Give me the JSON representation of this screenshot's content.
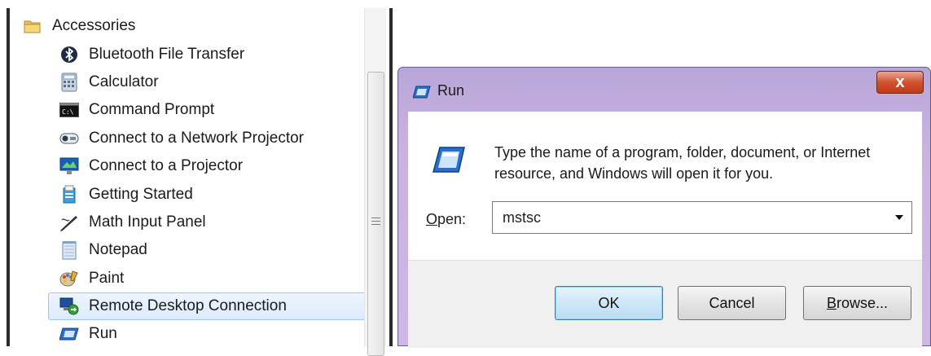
{
  "start_menu": {
    "folder": {
      "label": "Accessories",
      "icon": "folder-icon"
    },
    "items": [
      {
        "label": "Bluetooth File Transfer",
        "icon": "bluetooth-icon"
      },
      {
        "label": "Calculator",
        "icon": "calculator-icon"
      },
      {
        "label": "Command Prompt",
        "icon": "command-prompt-icon"
      },
      {
        "label": "Connect to a Network Projector",
        "icon": "network-projector-icon"
      },
      {
        "label": "Connect to a Projector",
        "icon": "projector-icon"
      },
      {
        "label": "Getting Started",
        "icon": "getting-started-icon"
      },
      {
        "label": "Math Input Panel",
        "icon": "math-input-icon"
      },
      {
        "label": "Notepad",
        "icon": "notepad-icon"
      },
      {
        "label": "Paint",
        "icon": "paint-icon"
      },
      {
        "label": "Remote Desktop Connection",
        "icon": "remote-desktop-icon",
        "selected": true
      },
      {
        "label": "Run",
        "icon": "run-icon"
      }
    ]
  },
  "run_dialog": {
    "title": "Run",
    "close_label": "x",
    "description": "Type the name of a program, folder, document, or Internet resource, and Windows will open it for you.",
    "open_label_accel": "O",
    "open_label_rest": "pen:",
    "open_value": "mstsc",
    "buttons": {
      "ok": "OK",
      "cancel": "Cancel",
      "browse_accel": "B",
      "browse_rest": "rowse..."
    }
  },
  "colors": {
    "selection_border": "#9ec3ec",
    "dialog_frame": "#c9b4e0",
    "close_button": "#d0532f"
  }
}
